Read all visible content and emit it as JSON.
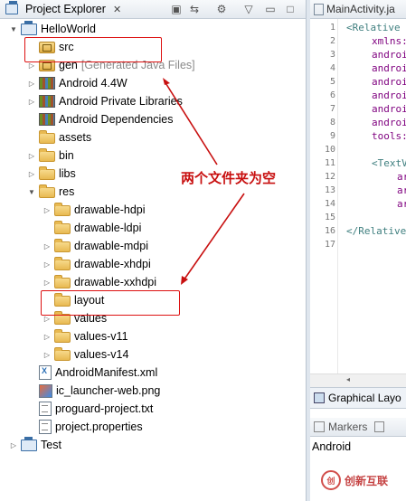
{
  "project_explorer": {
    "title": "Project Explorer",
    "close": "✕"
  },
  "tree": [
    {
      "label": "HelloWorld",
      "extra": "",
      "icon": "project-icon",
      "twisty": "▼"
    },
    {
      "label": "src",
      "extra": "",
      "icon": "package-folder-icon",
      "twisty": ""
    },
    {
      "label": "gen",
      "extra": "[Generated Java Files]",
      "icon": "package-folder-icon",
      "twisty": "▷"
    },
    {
      "label": "Android 4.4W",
      "extra": "",
      "icon": "library-icon",
      "twisty": "▷"
    },
    {
      "label": "Android Private Libraries",
      "extra": "",
      "icon": "library-icon",
      "twisty": "▷"
    },
    {
      "label": "Android Dependencies",
      "extra": "",
      "icon": "library-icon",
      "twisty": ""
    },
    {
      "label": "assets",
      "extra": "",
      "icon": "folder-icon",
      "twisty": ""
    },
    {
      "label": "bin",
      "extra": "",
      "icon": "folder-icon",
      "twisty": "▷"
    },
    {
      "label": "libs",
      "extra": "",
      "icon": "folder-icon",
      "twisty": "▷"
    },
    {
      "label": "res",
      "extra": "",
      "icon": "folder-icon",
      "twisty": "▼"
    },
    {
      "label": "drawable-hdpi",
      "extra": "",
      "icon": "folder-icon",
      "twisty": "▷"
    },
    {
      "label": "drawable-ldpi",
      "extra": "",
      "icon": "folder-icon",
      "twisty": ""
    },
    {
      "label": "drawable-mdpi",
      "extra": "",
      "icon": "folder-icon",
      "twisty": "▷"
    },
    {
      "label": "drawable-xhdpi",
      "extra": "",
      "icon": "folder-icon",
      "twisty": "▷"
    },
    {
      "label": "drawable-xxhdpi",
      "extra": "",
      "icon": "folder-icon",
      "twisty": "▷"
    },
    {
      "label": "layout",
      "extra": "",
      "icon": "folder-icon",
      "twisty": ""
    },
    {
      "label": "values",
      "extra": "",
      "icon": "folder-icon",
      "twisty": "▷"
    },
    {
      "label": "values-v11",
      "extra": "",
      "icon": "folder-icon",
      "twisty": "▷"
    },
    {
      "label": "values-v14",
      "extra": "",
      "icon": "folder-icon",
      "twisty": "▷"
    },
    {
      "label": "AndroidManifest.xml",
      "extra": "",
      "icon": "xml-file-icon",
      "twisty": ""
    },
    {
      "label": "ic_launcher-web.png",
      "extra": "",
      "icon": "image-file-icon",
      "twisty": ""
    },
    {
      "label": "proguard-project.txt",
      "extra": "",
      "icon": "text-file-icon",
      "twisty": ""
    },
    {
      "label": "project.properties",
      "extra": "",
      "icon": "text-file-icon",
      "twisty": ""
    },
    {
      "label": "Test",
      "extra": "",
      "icon": "project-icon",
      "twisty": "▷"
    }
  ],
  "annotation": "两个文件夹为空",
  "editor": {
    "tab": "MainActivity.ja",
    "line_numbers": [
      "1",
      "2",
      "3",
      "4",
      "5",
      "6",
      "7",
      "8",
      "9",
      "10",
      "11",
      "12",
      "13",
      "14",
      "15",
      "16",
      "17"
    ],
    "lines": [
      "<Relative",
      "xmlns:",
      "androi",
      "androi",
      "androi",
      "androi",
      "androi",
      "androi",
      "tools:",
      "",
      "<TextV",
      "ar",
      "ar",
      "ar",
      "",
      "</Relative",
      ""
    ],
    "graphical_tab": "Graphical Layo",
    "markers_tab": "Markers",
    "android_label": "Android"
  },
  "watermark": {
    "logo": "创",
    "text": "创新互联"
  },
  "colors": {
    "highlight_box": "#dd1111",
    "annotation": "#c81010"
  }
}
